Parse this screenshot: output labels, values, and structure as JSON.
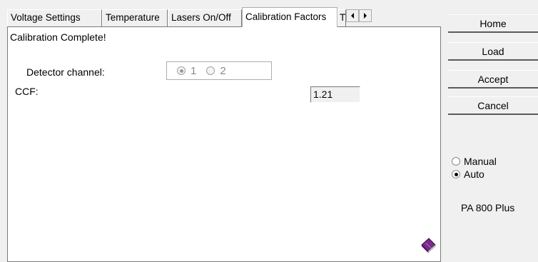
{
  "tabs": [
    {
      "label": "Voltage Settings",
      "active": false
    },
    {
      "label": "Temperature",
      "active": false
    },
    {
      "label": "Lasers On/Off",
      "active": false
    },
    {
      "label": "Calibration Factors",
      "active": true
    },
    {
      "label": "T",
      "active": false
    }
  ],
  "panel": {
    "status_text": "Calibration Complete!",
    "detector_label": "Detector channel:",
    "detector_options": [
      "1",
      "2"
    ],
    "detector_selected": "1",
    "ccf_label": "CCF:",
    "ccf_value": "1.21"
  },
  "actions": {
    "home": "Home",
    "load": "Load",
    "accept": "Accept",
    "cancel": "Cancel"
  },
  "mode": {
    "options": [
      "Manual",
      "Auto"
    ],
    "selected": "Auto"
  },
  "instrument": "PA 800 Plus",
  "colors": {
    "book_icon": "#7a2a8a",
    "window_bg": "#f0f0f0"
  }
}
